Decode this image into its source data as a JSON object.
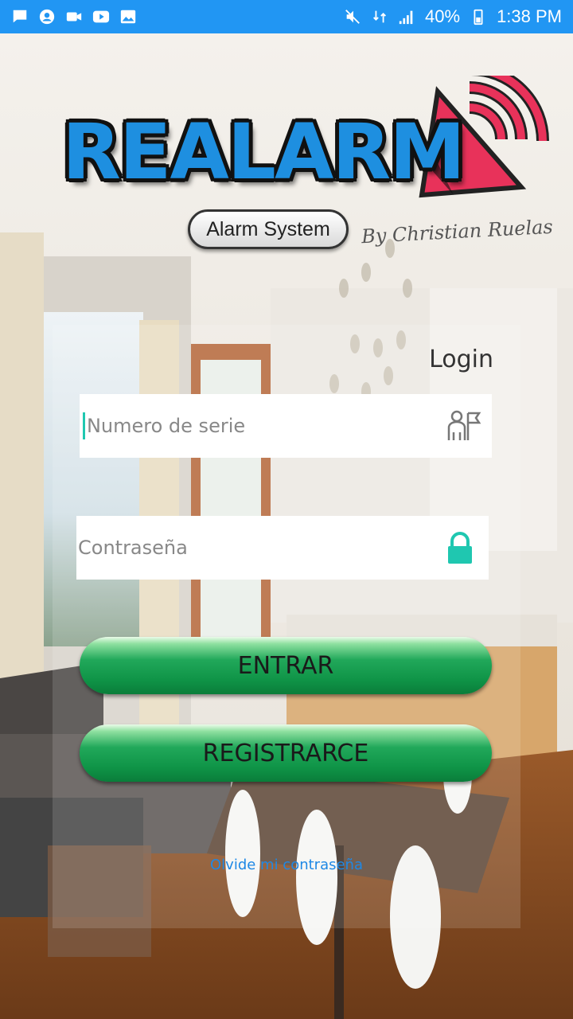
{
  "status_bar": {
    "battery": "40%",
    "time": "1:38 PM"
  },
  "logo": {
    "brand": "REALARM",
    "tagline": "Alarm System",
    "author": "By Christian Ruelas"
  },
  "login": {
    "title": "Login",
    "serial_placeholder": "Numero de serie",
    "password_placeholder": "Contraseña",
    "enter_button": "ENTRAR",
    "register_button": "REGISTRARCE",
    "forgot_link": "Olvide mi contraseña"
  },
  "colors": {
    "status_bar": "#2196f3",
    "accent": "#1fc7b0",
    "button_green": "#0f9447",
    "link_blue": "#1e88e5",
    "logo_blue": "#1e8fe0",
    "logo_red": "#e8325a"
  }
}
